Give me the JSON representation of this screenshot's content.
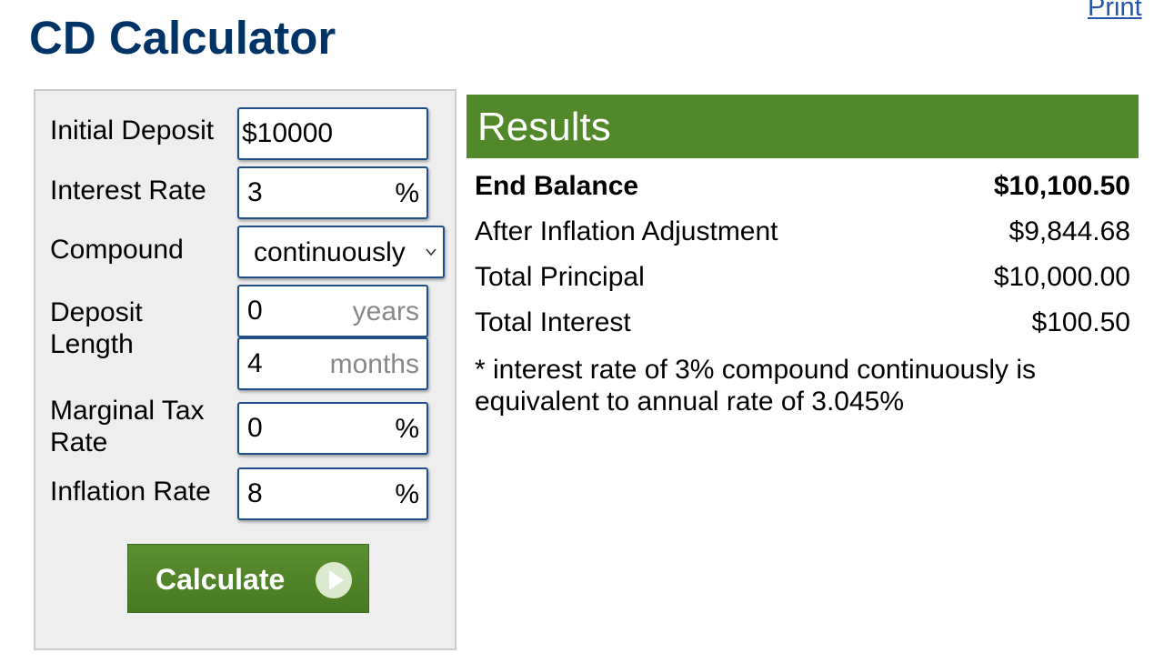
{
  "header": {
    "print_link": "Print",
    "title": "CD Calculator"
  },
  "form": {
    "initial_deposit": {
      "label": "Initial Deposit",
      "value": "$10000"
    },
    "interest_rate": {
      "label": "Interest Rate",
      "value": "3",
      "suffix": "%"
    },
    "compound": {
      "label": "Compound",
      "selected": "continuously"
    },
    "deposit_length": {
      "label_line1": "Deposit",
      "label_line2": "Length",
      "years_value": "0",
      "years_suffix": "years",
      "months_value": "4",
      "months_suffix": "months"
    },
    "marginal_tax_rate": {
      "label_line1": "Marginal Tax",
      "label_line2": "Rate",
      "value": "0",
      "suffix": "%"
    },
    "inflation_rate": {
      "label": "Inflation Rate",
      "value": "8",
      "suffix": "%"
    },
    "calculate_label": "Calculate"
  },
  "results": {
    "title": "Results",
    "rows": [
      {
        "label": "End Balance",
        "value": "$10,100.50"
      },
      {
        "label": "After Inflation Adjustment",
        "value": "$9,844.68"
      },
      {
        "label": "Total Principal",
        "value": "$10,000.00"
      },
      {
        "label": "Total Interest",
        "value": "$100.50"
      }
    ],
    "note_line1": "* interest rate of 3% compound continuously is",
    "note_line2": "equivalent to annual rate of 3.045%"
  },
  "colors": {
    "title": "#003366",
    "accent_green": "#51882a",
    "field_border": "#1f4f8b",
    "link": "#2356a8"
  }
}
